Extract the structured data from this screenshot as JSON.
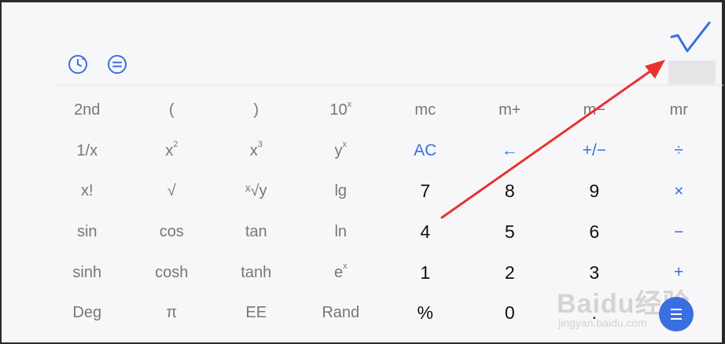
{
  "header": {
    "history_icon": "history-icon",
    "menu_icon": "menu-icon",
    "confirm_icon": "checkmark-icon",
    "display_value": ""
  },
  "keypad": {
    "rows": [
      [
        {
          "label": "2nd",
          "kind": "func"
        },
        {
          "label": "(",
          "kind": "func"
        },
        {
          "label": ")",
          "kind": "func"
        },
        {
          "label": "10",
          "sup": "x",
          "kind": "func"
        },
        {
          "label": "mc",
          "kind": "func"
        },
        {
          "label": "m+",
          "kind": "func"
        },
        {
          "label": "m−",
          "kind": "func"
        },
        {
          "label": "mr",
          "kind": "func"
        }
      ],
      [
        {
          "label": "1/x",
          "kind": "func"
        },
        {
          "label": "x",
          "sup": "2",
          "kind": "func"
        },
        {
          "label": "x",
          "sup": "3",
          "kind": "func"
        },
        {
          "label": "y",
          "sup": "x",
          "kind": "func"
        },
        {
          "label": "AC",
          "kind": "op"
        },
        {
          "label": "←",
          "kind": "op"
        },
        {
          "label": "+/−",
          "kind": "op"
        },
        {
          "label": "÷",
          "kind": "op"
        }
      ],
      [
        {
          "label": "x!",
          "kind": "func"
        },
        {
          "label": "√",
          "kind": "func"
        },
        {
          "label": "ˣ√y",
          "kind": "func"
        },
        {
          "label": "lg",
          "kind": "func"
        },
        {
          "label": "7",
          "kind": "digit"
        },
        {
          "label": "8",
          "kind": "digit"
        },
        {
          "label": "9",
          "kind": "digit"
        },
        {
          "label": "×",
          "kind": "op"
        }
      ],
      [
        {
          "label": "sin",
          "kind": "func"
        },
        {
          "label": "cos",
          "kind": "func"
        },
        {
          "label": "tan",
          "kind": "func"
        },
        {
          "label": "ln",
          "kind": "func"
        },
        {
          "label": "4",
          "kind": "digit"
        },
        {
          "label": "5",
          "kind": "digit"
        },
        {
          "label": "6",
          "kind": "digit"
        },
        {
          "label": "−",
          "kind": "op"
        }
      ],
      [
        {
          "label": "sinh",
          "kind": "func"
        },
        {
          "label": "cosh",
          "kind": "func"
        },
        {
          "label": "tanh",
          "kind": "func"
        },
        {
          "label": "e",
          "sup": "x",
          "kind": "func"
        },
        {
          "label": "1",
          "kind": "digit"
        },
        {
          "label": "2",
          "kind": "digit"
        },
        {
          "label": "3",
          "kind": "digit"
        },
        {
          "label": "+",
          "kind": "op"
        }
      ],
      [
        {
          "label": "Deg",
          "kind": "func"
        },
        {
          "label": "π",
          "kind": "func"
        },
        {
          "label": "EE",
          "kind": "func"
        },
        {
          "label": "Rand",
          "kind": "func"
        },
        {
          "label": "%",
          "kind": "digit"
        },
        {
          "label": "0",
          "kind": "digit"
        },
        {
          "label": ".",
          "kind": "digit"
        },
        {
          "label": "",
          "kind": "op"
        }
      ]
    ]
  },
  "fab": {
    "icon": "menu-lines-icon"
  },
  "watermark": {
    "main": "Baidu经验",
    "sub": "jingyan.baidu.com"
  },
  "annotation": {
    "arrow_color": "#e8322e"
  },
  "colors": {
    "accent": "#3a6fe0",
    "text_gray": "#777777",
    "digit": "#111111"
  }
}
